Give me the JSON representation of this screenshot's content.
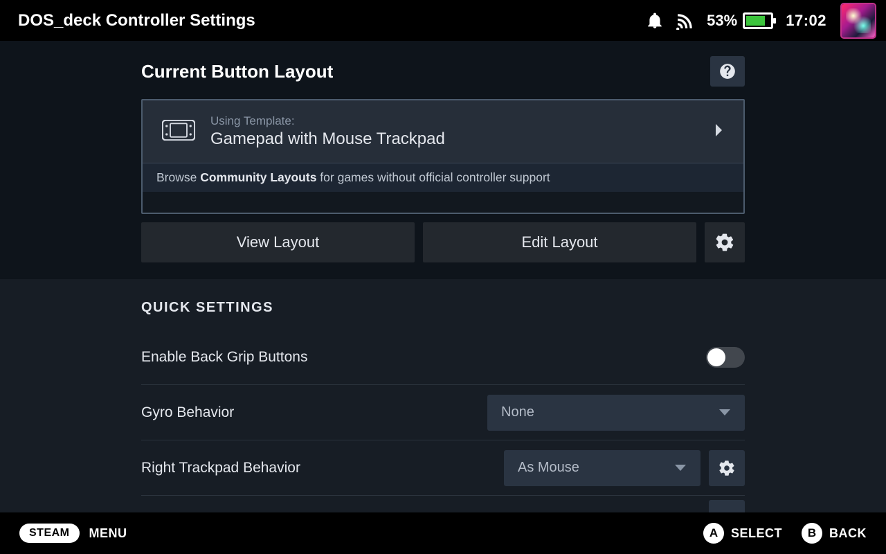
{
  "topbar": {
    "title": "DOS_deck Controller Settings",
    "battery_pct": "53%",
    "clock": "17:02"
  },
  "layout": {
    "header": "Current Button Layout",
    "template_eyebrow": "Using Template:",
    "template_name": "Gamepad with Mouse Trackpad",
    "community_pre": "Browse ",
    "community_bold": "Community Layouts",
    "community_post": " for games without official controller support",
    "view_btn": "View Layout",
    "edit_btn": "Edit Layout"
  },
  "quick": {
    "heading": "QUICK SETTINGS",
    "back_grip_label": "Enable Back Grip Buttons",
    "back_grip_on": false,
    "gyro_label": "Gyro Behavior",
    "gyro_value": "None",
    "rtp_label": "Right Trackpad Behavior",
    "rtp_value": "As Mouse"
  },
  "footer": {
    "steam": "STEAM",
    "menu": "MENU",
    "a_glyph": "A",
    "a_label": "SELECT",
    "b_glyph": "B",
    "b_label": "BACK"
  }
}
